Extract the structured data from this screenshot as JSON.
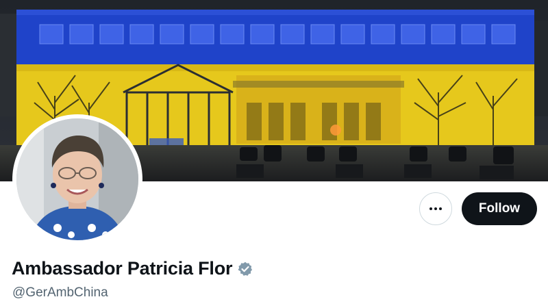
{
  "profile": {
    "display_name": "Ambassador Patricia Flor",
    "handle": "@GerAmbChina",
    "verified": true,
    "verified_badge_color": "#829aab"
  },
  "actions": {
    "follow_label": "Follow",
    "more_icon": "more-horizontal-icon"
  },
  "banner": {
    "description_icon": "building-lit-blue-yellow",
    "flag_colors": [
      "#1f43c9",
      "#f2d020"
    ]
  },
  "colors": {
    "follow_bg": "#0f1419",
    "handle_text": "#536471"
  }
}
